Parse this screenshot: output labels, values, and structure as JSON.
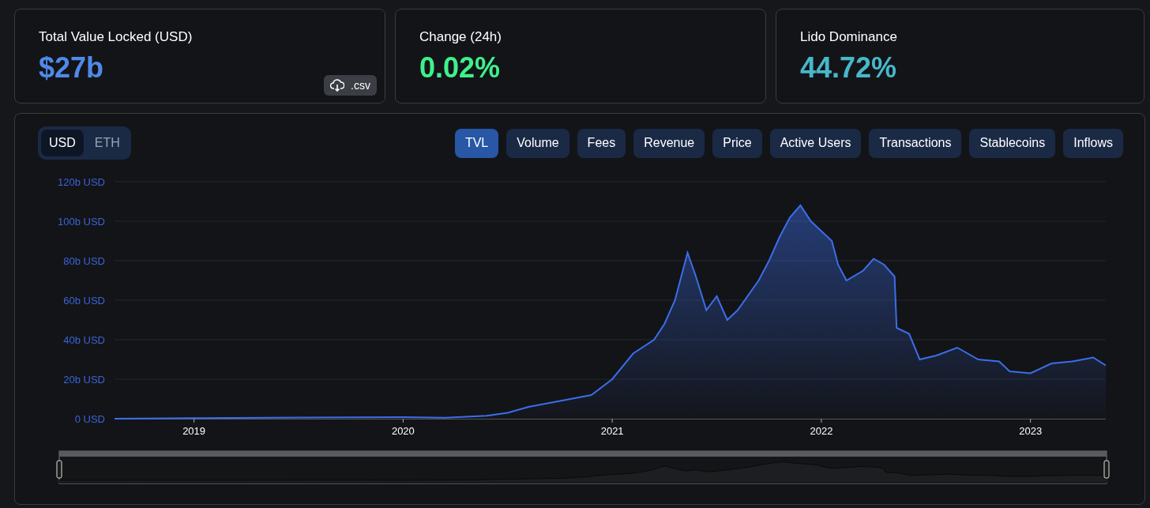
{
  "stats": [
    {
      "kind": "tvl",
      "label": "Total Value Locked (USD)",
      "value": "$27b",
      "color": "#4f8ae8",
      "download": ".csv"
    },
    {
      "kind": "plain",
      "label": "Change (24h)",
      "value": "0.02%",
      "color": "#3ff08b"
    },
    {
      "kind": "plain",
      "label": "Lido Dominance",
      "value": "44.72%",
      "color": "#47b8c9"
    }
  ],
  "denomination": [
    {
      "label": "USD",
      "selected": true
    },
    {
      "label": "ETH",
      "selected": false
    }
  ],
  "metric_tabs": [
    {
      "label": "TVL",
      "selected": true
    },
    {
      "label": "Volume",
      "selected": false
    },
    {
      "label": "Fees",
      "selected": false
    },
    {
      "label": "Revenue",
      "selected": false
    },
    {
      "label": "Price",
      "selected": false
    },
    {
      "label": "Active Users",
      "selected": false
    },
    {
      "label": "Transactions",
      "selected": false
    },
    {
      "label": "Stablecoins",
      "selected": false
    },
    {
      "label": "Inflows",
      "selected": false
    }
  ],
  "chart_data": {
    "type": "area",
    "grid": true,
    "xlim": [
      2018.62,
      2023.36
    ],
    "ylim": [
      0,
      120
    ],
    "xticks": [
      {
        "value": 2019,
        "label": "2019"
      },
      {
        "value": 2020,
        "label": "2020"
      },
      {
        "value": 2021,
        "label": "2021"
      },
      {
        "value": 2022,
        "label": "2022"
      },
      {
        "value": 2023,
        "label": "2023"
      }
    ],
    "yticks": [
      {
        "value": 0,
        "label": "0 USD"
      },
      {
        "value": 20,
        "label": "20b USD"
      },
      {
        "value": 40,
        "label": "40b USD"
      },
      {
        "value": 60,
        "label": "60b USD"
      },
      {
        "value": 80,
        "label": "80b USD"
      },
      {
        "value": 100,
        "label": "100b USD"
      },
      {
        "value": 120,
        "label": "120b USD"
      }
    ],
    "x": [
      2018.62,
      2019.0,
      2019.5,
      2020.0,
      2020.2,
      2020.4,
      2020.5,
      2020.6,
      2020.75,
      2020.9,
      2021.0,
      2021.1,
      2021.2,
      2021.25,
      2021.3,
      2021.36,
      2021.4,
      2021.45,
      2021.5,
      2021.55,
      2021.6,
      2021.7,
      2021.75,
      2021.8,
      2021.85,
      2021.9,
      2021.95,
      2022.0,
      2022.05,
      2022.08,
      2022.12,
      2022.2,
      2022.25,
      2022.3,
      2022.35,
      2022.36,
      2022.42,
      2022.47,
      2022.55,
      2022.65,
      2022.75,
      2022.85,
      2022.9,
      2023.0,
      2023.1,
      2023.2,
      2023.3,
      2023.36
    ],
    "series": [
      {
        "color": "#3b6ee8",
        "values": [
          0,
          0.3,
          0.6,
          0.8,
          0.5,
          1.5,
          3,
          6,
          9,
          12,
          20,
          33,
          40,
          48,
          60,
          84,
          72,
          55,
          62,
          50,
          55,
          70,
          80,
          92,
          102,
          108,
          100,
          95,
          90,
          78,
          70,
          75,
          81,
          78,
          72,
          46,
          43,
          30,
          32,
          36,
          30,
          29,
          24,
          23,
          28,
          29,
          31,
          27
        ]
      }
    ]
  }
}
